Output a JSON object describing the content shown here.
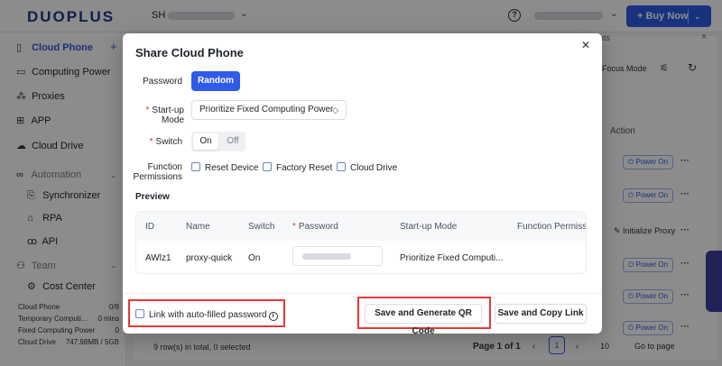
{
  "topbar": {
    "logo": "DUOPLUS",
    "region": "SH",
    "buy_label": "+ Buy Now"
  },
  "sidebar": {
    "items": [
      {
        "label": "Cloud Phone",
        "icon": "phone-icon"
      },
      {
        "label": "Computing Power",
        "icon": "monitor-icon"
      },
      {
        "label": "Proxies",
        "icon": "network-icon"
      },
      {
        "label": "APP",
        "icon": "grid-icon"
      },
      {
        "label": "Cloud Drive",
        "icon": "cloud-icon"
      },
      {
        "label": "Automation",
        "icon": "infinity-icon"
      },
      {
        "label": "Synchronizer",
        "icon": "sync-icon"
      },
      {
        "label": "RPA",
        "icon": "robot-icon"
      },
      {
        "label": "API",
        "icon": "api-icon"
      },
      {
        "label": "Team",
        "icon": "team-icon"
      },
      {
        "label": "Cost Center",
        "icon": "gear-icon"
      }
    ],
    "stats": [
      {
        "label": "Cloud Phone",
        "value": "0/9"
      },
      {
        "label": "Temporary Computi...",
        "value": "0 mins"
      },
      {
        "label": "Fixed Computing Power",
        "value": "0"
      },
      {
        "label": "Cloud Drive",
        "value": "747.98MB / 5GB"
      }
    ]
  },
  "background": {
    "tab_label": "uts",
    "focus_mode": "Focus Mode",
    "action_header": "Action",
    "power_on": "Power On",
    "initialize_proxy": "Initialize Proxy",
    "rows_info": "9 row(s) in total, 0 selected",
    "page_info": "Page 1 of 1",
    "current_page": "1",
    "page_size": "10",
    "go_to_page": "Go to page"
  },
  "modal": {
    "title": "Share Cloud Phone",
    "password_label": "Password",
    "random_button": "Random",
    "startup_label_1": "Start-up",
    "startup_label_2": "Mode",
    "startup_value": "Prioritize Fixed Computing Power",
    "switch_label": "Switch",
    "switch_on": "On",
    "switch_off": "Off",
    "function_label_1": "Function",
    "function_label_2": "Permissions",
    "permissions": [
      "Reset Device",
      "Factory Reset",
      "Cloud Drive"
    ],
    "preview_label": "Preview",
    "table": {
      "headers": [
        "ID",
        "Name",
        "Switch",
        "Password",
        "Start-up Mode",
        "Function Permissio"
      ],
      "row": {
        "id": "AWlz1",
        "name": "proxy-quick",
        "switch": "On",
        "startup_mode": "Prioritize Fixed Computi..."
      }
    },
    "link_option": "Link with auto-filled password",
    "qr_button": "Save and Generate QR Code",
    "copy_button": "Save and Copy Link"
  },
  "colors": {
    "primary": "#2f5bea",
    "highlight": "#e53935",
    "required": "#e03131"
  }
}
